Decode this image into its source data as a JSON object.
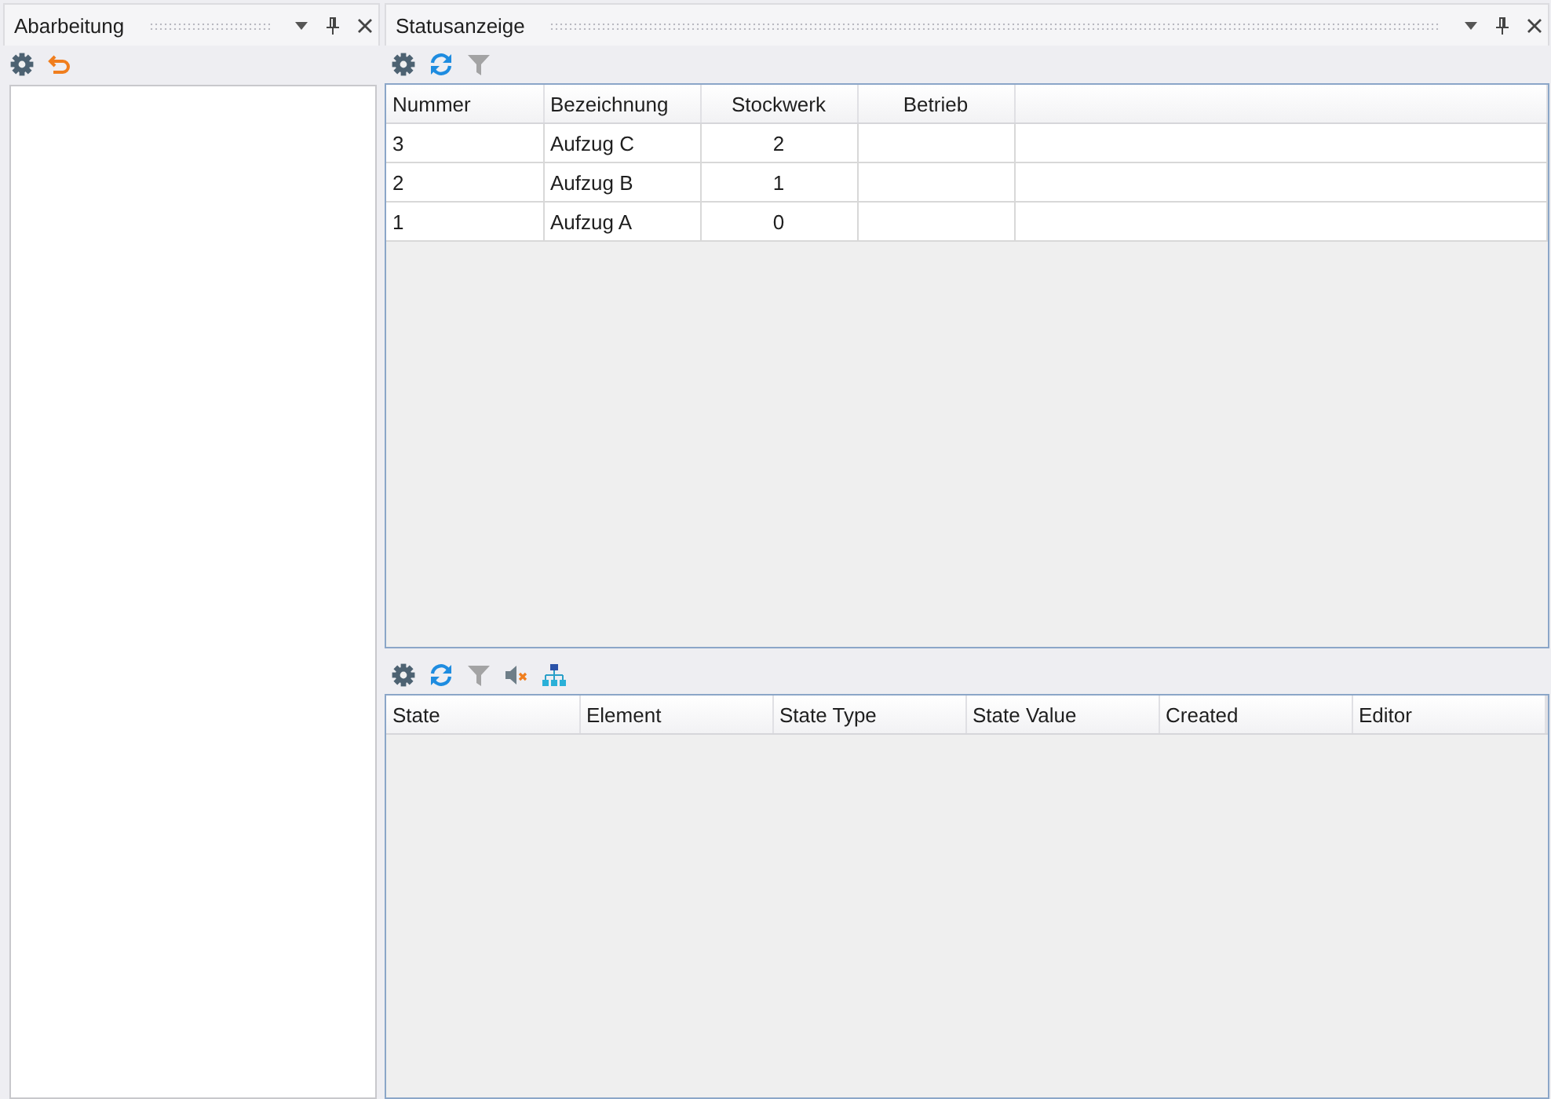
{
  "panels": [
    {
      "title": "Abarbeitung",
      "toolbar": [
        {
          "kind": "settings",
          "disabled": false
        },
        {
          "kind": "undo",
          "disabled": false
        }
      ],
      "body": {
        "kind": "list"
      }
    },
    {
      "title": "Statusanzeige",
      "toolbar": [
        {
          "kind": "settings",
          "disabled": false
        },
        {
          "kind": "refresh",
          "disabled": false
        },
        {
          "kind": "filter",
          "disabled": true
        }
      ],
      "body": {
        "kind": "split",
        "table": {
          "columns": [
            "Nummer",
            "Bezeichnung",
            "Stockwerk",
            "Betrieb"
          ],
          "rows": [
            [
              "3",
              "Aufzug C",
              "2",
              null
            ],
            [
              "2",
              "Aufzug B",
              "1",
              null
            ],
            [
              "1",
              "Aufzug A",
              "0",
              null
            ]
          ]
        },
        "lower_toolbar": [
          {
            "kind": "settings",
            "disabled": false
          },
          {
            "kind": "refresh",
            "disabled": false
          },
          {
            "kind": "filter",
            "disabled": true
          },
          {
            "kind": "mute",
            "disabled": false
          },
          {
            "kind": "hierarchy",
            "disabled": false
          }
        ],
        "lower_table": {
          "columns": [
            "State",
            "Element",
            "State Type",
            "State Value",
            "Created",
            "Editor"
          ]
        }
      }
    }
  ]
}
